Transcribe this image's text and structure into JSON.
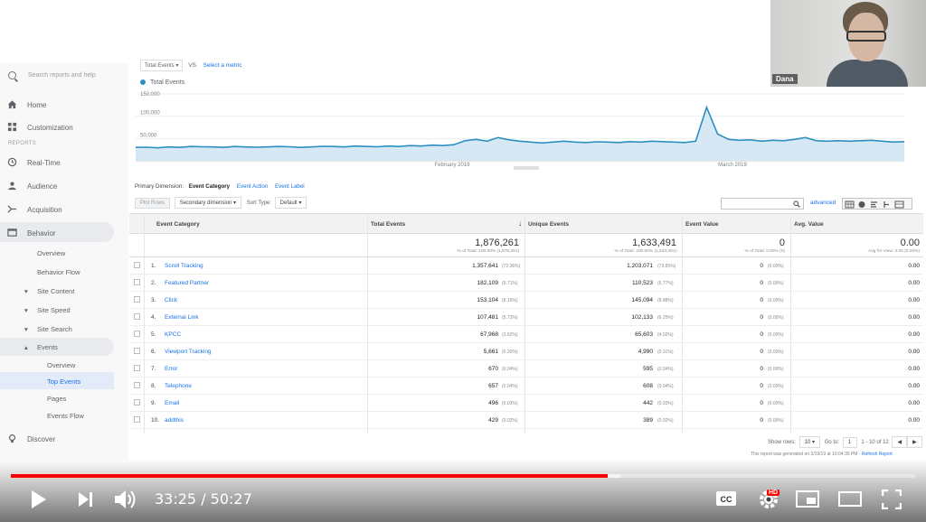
{
  "sidebar": {
    "search_placeholder": "Search reports and help",
    "home": "Home",
    "customization": "Customization",
    "reports_label": "REPORTS",
    "realtime": "Real-Time",
    "audience": "Audience",
    "acquisition": "Acquisition",
    "behavior": "Behavior",
    "overview": "Overview",
    "behavior_flow": "Behavior Flow",
    "site_content": "Site Content",
    "site_speed": "Site Speed",
    "site_search": "Site Search",
    "events": "Events",
    "events_overview": "Overview",
    "top_events": "Top Events",
    "pages": "Pages",
    "events_flow": "Events Flow",
    "discover": "Discover"
  },
  "chart_controls": {
    "metric": "Total Events",
    "vs": "VS.",
    "select_metric": "Select a metric",
    "legend": "Total Events"
  },
  "chart_data": {
    "type": "area",
    "series": [
      {
        "name": "Total Events",
        "values": [
          30000,
          30500,
          29000,
          31000,
          30000,
          32000,
          31500,
          31000,
          30000,
          32000,
          31000,
          30500,
          31000,
          32000,
          31500,
          30000,
          31000,
          32500,
          32000,
          31000,
          33000,
          32000,
          31500,
          33000,
          32000,
          34000,
          33000,
          35000,
          34000,
          36000,
          45000,
          48000,
          44000,
          52000,
          47000,
          44000,
          42000,
          40000,
          42000,
          44000,
          42000,
          41000,
          42500,
          42000,
          41000,
          43000,
          42000,
          44000,
          43000,
          42000,
          41000,
          44000,
          120000,
          60000,
          48000,
          46000,
          47000,
          44000,
          46000,
          45000,
          48000,
          52000,
          45000,
          44000,
          45000,
          44000,
          45000,
          46000,
          44000,
          42000,
          43000
        ]
      }
    ],
    "x_tick_labels": [
      "February 2019",
      "March 2019"
    ],
    "y_tick_labels": [
      "150,000",
      "100,000",
      "50,000"
    ],
    "ylim": [
      0,
      150000
    ],
    "grid": true,
    "legend_position": "top-left"
  },
  "dimension_row": {
    "label": "Primary Dimension:",
    "selected": "Event Category",
    "option2": "Event Action",
    "option3": "Event Label"
  },
  "controls": {
    "plot_rows": "Plot Rows",
    "secondary_dimension": "Secondary dimension",
    "sort_type_label": "Sort Type:",
    "sort_type_value": "Default",
    "advanced": "advanced"
  },
  "table": {
    "headers": {
      "event_category": "Event Category",
      "total_events": "Total Events",
      "unique_events": "Unique Events",
      "event_value": "Event Value",
      "avg_value": "Avg. Value"
    },
    "totals": {
      "total_events": "1,876,261",
      "total_events_sub": "% of Total: 100.00% (1,876,261)",
      "unique_events": "1,633,491",
      "unique_events_sub": "% of Total: 100.00% (1,633,491)",
      "event_value": "0",
      "event_value_sub": "% of Total: 0.00% (0)",
      "avg_value": "0.00",
      "avg_value_sub": "Avg for View: 0.00 (0.00%)"
    },
    "rows": [
      {
        "n": "1.",
        "name": "Scroll Tracking",
        "te": "1,357,641",
        "tp": "(72.36%)",
        "ue": "1,203,071",
        "up": "(73.65%)",
        "ev": "0",
        "ep": "(0.00%)",
        "av": "0.00"
      },
      {
        "n": "2.",
        "name": "Featured Partner",
        "te": "182,109",
        "tp": "(9.71%)",
        "ue": "110,523",
        "up": "(6.77%)",
        "ev": "0",
        "ep": "(0.00%)",
        "av": "0.00"
      },
      {
        "n": "3.",
        "name": "Click",
        "te": "153,104",
        "tp": "(8.16%)",
        "ue": "145,094",
        "up": "(8.88%)",
        "ev": "0",
        "ep": "(0.00%)",
        "av": "0.00"
      },
      {
        "n": "4.",
        "name": "External Link",
        "te": "107,481",
        "tp": "(5.73%)",
        "ue": "102,133",
        "up": "(6.25%)",
        "ev": "0",
        "ep": "(0.00%)",
        "av": "0.00"
      },
      {
        "n": "5.",
        "name": "KPCC",
        "te": "67,968",
        "tp": "(3.62%)",
        "ue": "65,603",
        "up": "(4.02%)",
        "ev": "0",
        "ep": "(0.00%)",
        "av": "0.00"
      },
      {
        "n": "6.",
        "name": "Viewport Tracking",
        "te": "5,661",
        "tp": "(0.30%)",
        "ue": "4,990",
        "up": "(0.31%)",
        "ev": "0",
        "ep": "(0.00%)",
        "av": "0.00"
      },
      {
        "n": "7.",
        "name": "Error",
        "te": "670",
        "tp": "(0.04%)",
        "ue": "595",
        "up": "(0.04%)",
        "ev": "0",
        "ep": "(0.00%)",
        "av": "0.00"
      },
      {
        "n": "8.",
        "name": "Telephone",
        "te": "657",
        "tp": "(0.04%)",
        "ue": "608",
        "up": "(0.04%)",
        "ev": "0",
        "ep": "(0.00%)",
        "av": "0.00"
      },
      {
        "n": "9.",
        "name": "Email",
        "te": "496",
        "tp": "(0.03%)",
        "ue": "442",
        "up": "(0.03%)",
        "ev": "0",
        "ep": "(0.00%)",
        "av": "0.00"
      },
      {
        "n": "10.",
        "name": "addthis",
        "te": "429",
        "tp": "(0.02%)",
        "ue": "389",
        "up": "(0.02%)",
        "ev": "0",
        "ep": "(0.00%)",
        "av": "0.00"
      }
    ]
  },
  "pagination": {
    "show_rows_label": "Show rows:",
    "show_rows_value": "10",
    "goto_label": "Go to:",
    "goto_value": "1",
    "range": "1 - 10 of 12"
  },
  "report_note": {
    "text": "This report was generated on 3/19/19 at 10:04:35 PM -",
    "refresh": "Refresh Report"
  },
  "webcam": {
    "name": "Dana"
  },
  "player": {
    "time": "33:25 / 50:27",
    "progress_fraction": 0.66,
    "buffered_fraction": 0.674,
    "hd_badge": "HD",
    "accent": "#ff0000"
  }
}
